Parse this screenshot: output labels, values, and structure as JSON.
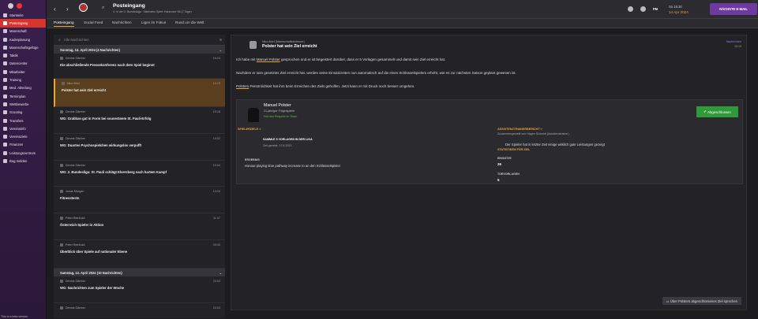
{
  "sidebar": {
    "items": [
      {
        "label": "Startseite"
      },
      {
        "label": "Posteingang"
      },
      {
        "label": "Mannschaft"
      },
      {
        "label": "Kaderplanung"
      },
      {
        "label": "Mannschaftsgefüge"
      },
      {
        "label": "Taktik"
      },
      {
        "label": "Datencenter"
      },
      {
        "label": "Mitarbeiter"
      },
      {
        "label": "Training"
      },
      {
        "label": "Med. Abteilung"
      },
      {
        "label": "Terminplan"
      },
      {
        "label": "Wettbewerbe"
      },
      {
        "label": "Scouting"
      },
      {
        "label": "Transfers"
      },
      {
        "label": "Vereinsinfo"
      },
      {
        "label": "Vereinsziele"
      },
      {
        "label": "Finanzen"
      },
      {
        "label": "Leistungszentrum"
      },
      {
        "label": "Bug melden"
      }
    ],
    "footer": "This is a beta version"
  },
  "topbar": {
    "title": "Posteingang",
    "subtitle": "4. in der 2. Bundesliga · Nächstes Spiel: Hannover 96 (7 Tage)",
    "fm": "FM",
    "time": "So 15:30",
    "date": "14 Apr 2024",
    "next_button": "NÄCHSTE E-MAIL"
  },
  "tabs": [
    "Posteingang",
    "Social Feed",
    "Nachrichten",
    "Ligen im Fokus",
    "Rund um die Welt"
  ],
  "inbox": {
    "search_placeholder": "Alle Nachrichten",
    "day1": "Sonntag, 14. April 2024 (4 Nachrichten)",
    "messages1": [
      {
        "sender": "Dennis Gärtner",
        "subject": "Die abschließende Pressekonferenz nach dem Spiel beginnt",
        "time": "15:24"
      },
      {
        "sender": "Nico Abel",
        "subject": "Polster hat sein Ziel erreicht",
        "time": "15:19"
      },
      {
        "sender": "Dennis Gärtner",
        "subject": "WG: Grabban gut in Form bei souveränem St. Pauli-Erfolg",
        "time": "15:18"
      },
      {
        "sender": "Dennis Gärtner",
        "subject": "WG: Duartes Psychospielchen wirkungslos verpufft",
        "time": "15:02"
      },
      {
        "sender": "Dennis Gärtner",
        "subject": "WG: 2. Bundesliga: St. Pauli schlägt Elversberg nach hartem Kampf",
        "time": "15:04"
      },
      {
        "sender": "Jonas Morgan",
        "subject": "Fitnesstests",
        "time": "13:24"
      },
      {
        "sender": "Peter Reinhold",
        "subject": "Österreich-Spieler in Aktion",
        "time": "11:47"
      },
      {
        "sender": "Peter Reinhold",
        "subject": "Überblick über Spiele auf nationaler Ebene",
        "time": "09:30"
      }
    ],
    "day2": "Samstag, 13. April 2024 (10 Nachrichten)",
    "messages2": [
      {
        "sender": "Dennis Gärtner",
        "subject": "WG: Nachrichten zum Spieler der Woche",
        "time": "20:03"
      },
      {
        "sender": "Dennis Gärtner",
        "subject": "",
        "time": "20:03"
      }
    ]
  },
  "detail": {
    "from": "Nico Abel (Mannschaftsbetreuer)",
    "subject": "Polster hat sein Ziel erreicht",
    "category": "Nachrichten",
    "date": "15:19",
    "para1_pre": "Ich habe mit ",
    "para1_link": "Manuel Polster",
    "para1_post": " gesprochen und er ist begeistert darüber, dass er 5 Vorlagen gesammelt und damit sein Ziel erreicht hat.",
    "para2": "Nachdem er sein gesetztes Ziel erreicht hat, werden seine Einsatzzeiten nun automatisch auf die eines Schlüsselspielers erhöht, wie es zur nächsten Saison geplant gewesen ist.",
    "para3_link": "Polsters",
    "para3_post": " Persönlichkeit hat ihm beim Erreichen des Ziels geholfen. Jetzt kann er mit Druck noch besser umgehen.",
    "player": {
      "name": "Manuel Polster",
      "desc": "21-jähriger Flügelspieler",
      "status": "Hat den Respekt im Team"
    },
    "done_button": "Abgeschlossen",
    "goal_section": "SPIELERZIELE >",
    "goal_title": "SAMMLE 5 VORLAGEN IN DER LIGA",
    "goal_date": "Ziel gesetzt: 17.8.2023",
    "reward_label": "ERGEBNIS",
    "reward_text": "Honour playing time pathway increase to an den Schlüsselspieler",
    "report_section": "ASSISTENZTRAINERBERICHT >",
    "report_sub": "Zusammengestellt von Hagen Schmidt (Assistenztrainer)",
    "report_text": "Der Spieler hat in letzter Zeit einige wirklich gute Leistungen gezeigt",
    "stats_section": "STATISTIKEN FÜR ZIEL",
    "stats": [
      {
        "label": "EINSÄTZE",
        "value": "26"
      },
      {
        "label": "TORVORLAGEN",
        "value": "5"
      }
    ],
    "bottom_button": "Über Polsters abgeschlossenes Ziel sprechen"
  }
}
